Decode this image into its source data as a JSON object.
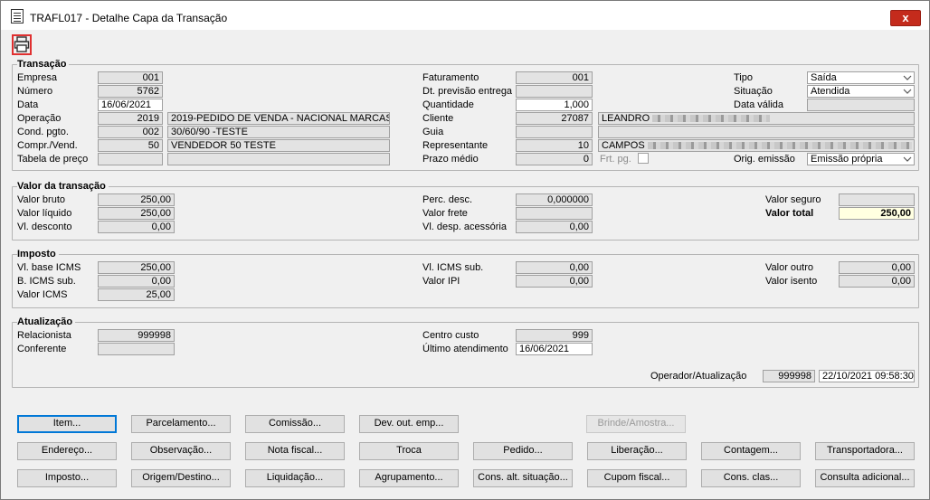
{
  "window": {
    "title": "TRAFL017 - Detalhe Capa da Transação",
    "close_label": "x"
  },
  "transacao": {
    "title": "Transação",
    "empresa_label": "Empresa",
    "empresa": "001",
    "numero_label": "Número",
    "numero": "5762",
    "data_label": "Data",
    "data": "16/06/2021",
    "operacao_label": "Operação",
    "operacao_cod": "2019",
    "operacao_desc": "2019-PEDIDO DE VENDA - NACIONAL MARCAS",
    "cond_label": "Cond. pgto.",
    "cond_cod": "002",
    "cond_desc": "30/60/90 -TESTE",
    "compr_label": "Compr./Vend.",
    "compr_cod": "50",
    "compr_desc": "VENDEDOR 50 TESTE",
    "tabela_label": "Tabela de preço",
    "faturamento_label": "Faturamento",
    "faturamento": "001",
    "dtprev_label": "Dt. previsão entrega",
    "quantidade_label": "Quantidade",
    "quantidade": "1,000",
    "cliente_label": "Cliente",
    "cliente_cod": "27087",
    "cliente_nome": "LEANDRO",
    "guia_label": "Guia",
    "representante_label": "Representante",
    "representante_cod": "10",
    "representante_nome": "CAMPOS",
    "prazo_label": "Prazo médio",
    "prazo": "0",
    "frt_label": "Frt. pg.",
    "tipo_label": "Tipo",
    "tipo": "Saída",
    "situacao_label": "Situação",
    "situacao": "Atendida",
    "datavalida_label": "Data válida",
    "orig_label": "Orig. emissão",
    "orig": "Emissão própria"
  },
  "valor": {
    "title": "Valor da transação",
    "bruto_label": "Valor bruto",
    "bruto": "250,00",
    "liquido_label": "Valor líquido",
    "liquido": "250,00",
    "desconto_label": "Vl. desconto",
    "desconto": "0,00",
    "percdesc_label": "Perc. desc.",
    "percdesc": "0,000000",
    "frete_label": "Valor frete",
    "despacess_label": "Vl. desp. acessória",
    "despacess": "0,00",
    "seguro_label": "Valor seguro",
    "total_label": "Valor total",
    "total": "250,00"
  },
  "imposto": {
    "title": "Imposto",
    "baseicms_label": "Vl. base ICMS",
    "baseicms": "250,00",
    "bicmssub_label": "B. ICMS sub.",
    "bicmssub": "0,00",
    "icms_label": "Valor ICMS",
    "icms": "25,00",
    "vlicmssub_label": "Vl. ICMS sub.",
    "vlicmssub": "0,00",
    "ipi_label": "Valor IPI",
    "ipi": "0,00",
    "outro_label": "Valor outro",
    "outro": "0,00",
    "isento_label": "Valor isento",
    "isento": "0,00"
  },
  "atualizacao": {
    "title": "Atualização",
    "relacionista_label": "Relacionista",
    "relacionista": "999998",
    "conferente_label": "Conferente",
    "centro_label": "Centro custo",
    "centro": "999",
    "ultimo_label": "Último atendimento",
    "ultimo": "16/06/2021",
    "operador_label": "Operador/Atualização",
    "operador": "999998",
    "operador_data": "22/10/2021 09:58:30"
  },
  "buttons": {
    "row1": [
      "Item...",
      "Parcelamento...",
      "Comissão...",
      "Dev. out. emp...",
      "Brinde/Amostra..."
    ],
    "row2": [
      "Endereço...",
      "Observação...",
      "Nota fiscal...",
      "Troca",
      "Pedido...",
      "Liberação...",
      "Contagem...",
      "Transportadora..."
    ],
    "row3": [
      "Imposto...",
      "Origem/Destino...",
      "Liquidação...",
      "Agrupamento...",
      "Cons. alt. situação...",
      "Cupom fiscal...",
      "Cons. clas...",
      "Consulta adicional..."
    ]
  }
}
